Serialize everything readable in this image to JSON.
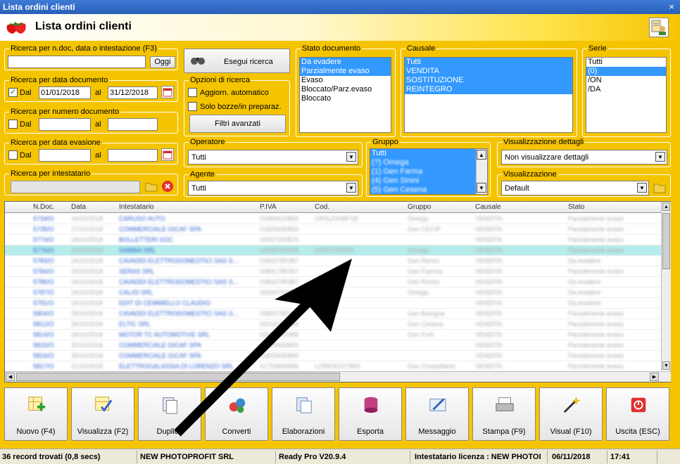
{
  "window": {
    "title": "Lista ordini clienti",
    "close": "×"
  },
  "header": {
    "title": "Lista ordini clienti"
  },
  "search_ndoc": {
    "legend": "Ricerca per n.doc, data o intestazione (F3)",
    "value": "",
    "today_button": "Oggi"
  },
  "search_date": {
    "legend": "Ricerca per data documento",
    "checked": true,
    "dal_label": "Dal",
    "from": "01/01/2018",
    "al_label": "al",
    "to": "31/12/2018"
  },
  "search_number": {
    "legend": "Ricerca per numero documento",
    "checked": false,
    "dal_label": "Dal",
    "from": "",
    "al_label": "al",
    "to": ""
  },
  "search_evasion": {
    "legend": "Ricerca per data evasione",
    "checked": false,
    "dal_label": "Dal",
    "from": "",
    "al_label": "al",
    "to": ""
  },
  "search_holder": {
    "legend": "Ricerca per intestatario",
    "value": ""
  },
  "run_search": {
    "label": "Esegui ricerca"
  },
  "search_options": {
    "legend": "Opzioni di ricerca",
    "auto_update": "Aggiorn. automatico",
    "drafts_only": "Solo bozze/in preparaz.",
    "advanced_filters": "Filtri avanzati"
  },
  "operatore": {
    "legend": "Operatore",
    "value": "Tutti"
  },
  "agente": {
    "legend": "Agente",
    "value": "Tutti"
  },
  "stato_documento": {
    "legend": "Stato documento",
    "items": [
      {
        "label": "Da evadere",
        "selected": true
      },
      {
        "label": "Parzialmente evaso",
        "selected": true
      },
      {
        "label": "Evaso",
        "selected": false
      },
      {
        "label": "Bloccato/Parz.evaso",
        "selected": false
      },
      {
        "label": "Bloccato",
        "selected": false
      }
    ]
  },
  "causale": {
    "legend": "Causale",
    "items": [
      {
        "label": "Tutti",
        "selected": true
      },
      {
        "label": "VENDITA",
        "selected": true
      },
      {
        "label": "SOSTITUZIONE",
        "selected": true
      },
      {
        "label": "REINTEGRO",
        "selected": true
      }
    ]
  },
  "serie": {
    "legend": "Serie",
    "items": [
      {
        "label": "Tutti",
        "selected": false
      },
      {
        "label": "(0)",
        "selected": true
      },
      {
        "label": "/ON",
        "selected": false
      },
      {
        "label": "/DA",
        "selected": false
      }
    ]
  },
  "gruppo": {
    "legend": "Gruppo",
    "items": [
      {
        "label": "Tutti"
      },
      {
        "label": "(?) Omega"
      },
      {
        "label": "(1) Gen Farma"
      },
      {
        "label": "(4) Gen Sinini"
      },
      {
        "label": "(5) Gen Cesena"
      }
    ]
  },
  "vis_dettagli": {
    "legend": "Visualizzazione dettagli",
    "value": "Non visualizzare dettagli"
  },
  "visualizzazione": {
    "legend": "Visualizzazione",
    "value": "Default"
  },
  "grid": {
    "columns": [
      "N.Doc.",
      "Data",
      "Intestatario",
      "P.IVA",
      "Cod.",
      "Gruppo",
      "Causale",
      "Stato"
    ],
    "rows": [
      [
        "5734/O",
        "16/10/2018",
        "CARUSO AUTO",
        "01860610892",
        "CRSLFA48F1B",
        "Omega",
        "VENDITA",
        "Parzialmente evaso"
      ],
      [
        "5735/O",
        "17/10/2018",
        "COMMERCIALE GICAF SPA",
        "01825630893",
        "",
        "Gen CECIP",
        "VENDITA",
        "Parzialmente evaso"
      ],
      [
        "5774/O",
        "18/10/2018",
        "BOLLETTERI SOC",
        "02047150876",
        "",
        "",
        "VENDITA",
        "Parzialmente evaso"
      ],
      [
        "5776/O",
        "24/10/2018",
        "SABBIA SRL",
        "02059700858",
        "02059700858",
        "Omega",
        "VENDITA",
        "Parzialmente evaso"
      ],
      [
        "5783/O",
        "24/10/2018",
        "CAVADDI ELETTRODOMESTICI SAS S...",
        "03842780387",
        "",
        "Gen Ronini",
        "VENDITA",
        "Da evadere"
      ],
      [
        "5784/O",
        "24/10/2018",
        "SERAS SRL",
        "03841780367",
        "",
        "Gen Faenza",
        "VENDITA",
        "Parzialmente evaso"
      ],
      [
        "5786/O",
        "24/10/2018",
        "CAVADDI ELETTRODOMESTICI SAS S...",
        "03842780387",
        "",
        "Gen Ronini",
        "VENDITA",
        "Da evadere"
      ],
      [
        "5787/O",
        "24/10/2018",
        "CALISI SRL",
        "02049700858",
        "",
        "Omega",
        "VENDITA",
        "Da evadere"
      ],
      [
        "5791/O",
        "24/10/2018",
        "EDIT DI CEMMIELLO CLAUDIO",
        "",
        "",
        "",
        "VENDITA",
        "Da evadere"
      ],
      [
        "5804/O",
        "25/10/2018",
        "CAVADDI ELETTRODOMESTICI SAS S...",
        "03842780387",
        "",
        "Gen Bologna",
        "VENDITA",
        "Parzialmente evaso"
      ],
      [
        "5812/O",
        "26/10/2018",
        "ELTIC SRL",
        "02016300389",
        "",
        "Gen Cesena",
        "VENDITA",
        "Parzialmente evaso"
      ],
      [
        "5814/O",
        "26/10/2018",
        "MOTOR TC AUTOMOTIVE SRL",
        "02097200389",
        "",
        "Gen Forli",
        "VENDITA",
        "Parzialmente evaso"
      ],
      [
        "5815/O",
        "30/10/2018",
        "COMMERCIALE GICAF SPA",
        "01825630893",
        "",
        "",
        "VENDITA",
        "Parzialmente evaso"
      ],
      [
        "5816/O",
        "30/10/2018",
        "COMMERCIALE GICAF SPA",
        "01825630893",
        "",
        "",
        "VENDITA",
        "Parzialmente evaso"
      ],
      [
        "5817/O",
        "31/10/2018",
        "ELETTROGALASSIA DI LORENZO SRL",
        "01753650896",
        "LORENZO78E6",
        "Gen Crespellano",
        "VENDITA",
        "Parzialmente evaso"
      ]
    ]
  },
  "toolbar": {
    "buttons": [
      "Nuovo (F4)",
      "Visualizza (F2)",
      "Duplica",
      "Converti",
      "Elaborazioni",
      "Esporta",
      "Messaggio",
      "Stampa (F9)",
      "Visual (F10)",
      "Uscita (ESC)"
    ]
  },
  "status": {
    "records": "36 record trovati (0,8 secs)",
    "company": "NEW PHOTOPROFIT SRL",
    "version": "Ready Pro V20.9.4",
    "license": "Intestatario licenza : NEW PHOTOI",
    "date": "06/11/2018",
    "time": "17:41"
  }
}
